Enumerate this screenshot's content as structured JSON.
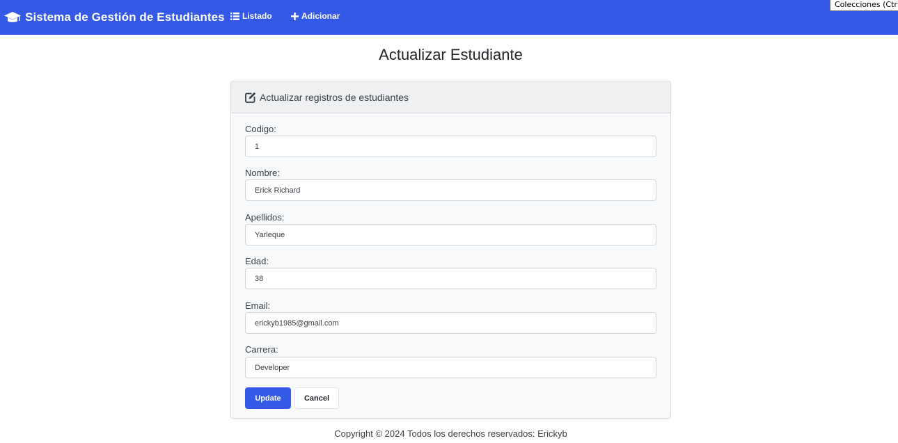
{
  "navbar": {
    "brand_icon": "graduation-cap-icon",
    "brand": "Sistema de Gestión de Estudiantes",
    "links": [
      {
        "label": "Listado",
        "icon": "list-icon"
      },
      {
        "label": "Adicionar",
        "icon": "plus-icon"
      }
    ],
    "background_color": "#3459e6"
  },
  "tooltip": "Colecciones (Ctrl+",
  "page_title": "Actualizar Estudiante",
  "card": {
    "header_icon": "edit-icon",
    "header": "Actualizar registros de estudiantes",
    "fields": [
      {
        "label": "Codigo:",
        "value": "1"
      },
      {
        "label": "Nombre:",
        "value": "Erick Richard"
      },
      {
        "label": "Apellidos:",
        "value": "Yarleque"
      },
      {
        "label": "Edad:",
        "value": "38"
      },
      {
        "label": "Email:",
        "value": "erickyb1985@gmail.com"
      },
      {
        "label": "Carrera:",
        "value": "Developer"
      }
    ],
    "buttons": {
      "update": "Update",
      "cancel": "Cancel"
    }
  },
  "footer": "Copyright © 2024 Todos los derechos reservados: Erickyb"
}
